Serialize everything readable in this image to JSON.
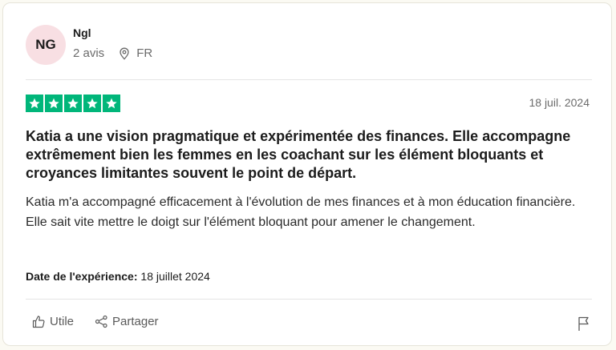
{
  "reviewer": {
    "initials": "NG",
    "name": "Ngl",
    "reviews_count": "2 avis",
    "country": "FR"
  },
  "review": {
    "rating": 5,
    "date": "18 juil. 2024",
    "title": "Katia a une vision pragmatique et expérimentée des finances. Elle accompagne extrêmement bien les femmes en les coachant sur les élément bloquants et croyances limitantes souvent le point de départ.",
    "body": "Katia m'a accompagné efficacement à l'évolution de mes finances et à mon éducation financière. Elle sait vite mettre le doigt sur l'élément bloquant pour amener le changement.",
    "experience_label": "Date de l'expérience:",
    "experience_date": "18 juillet 2024"
  },
  "actions": {
    "useful_label": "Utile",
    "share_label": "Partager"
  },
  "colors": {
    "star_green": "#00b67a",
    "avatar_bg": "#f8dfe3",
    "page_bg": "#fbfaf3"
  },
  "icons": [
    "star-icon",
    "location-pin-icon",
    "thumbs-up-icon",
    "share-icon",
    "flag-icon"
  ]
}
